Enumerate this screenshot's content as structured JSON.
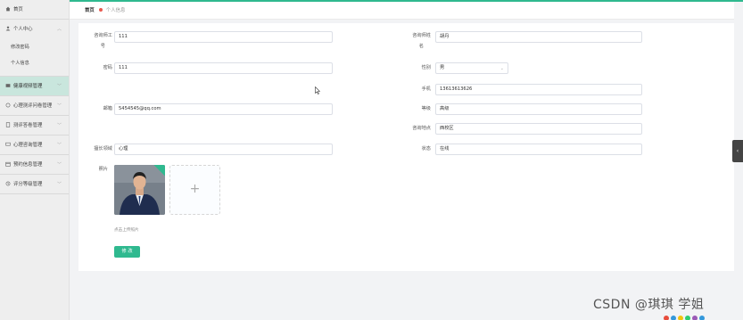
{
  "sidebar": {
    "home": "首页",
    "personal_center": "个人中心",
    "change_password": "修改密码",
    "personal_info": "个人信息",
    "items": [
      {
        "label": "健康视频管理"
      },
      {
        "label": "心理测评问卷管理"
      },
      {
        "label": "测评答卷管理"
      },
      {
        "label": "心理咨询管理"
      },
      {
        "label": "预约信息管理"
      },
      {
        "label": "评分等级管理"
      }
    ]
  },
  "breadcrumb": {
    "home": "首页",
    "current": "个人信息"
  },
  "form": {
    "left": [
      {
        "label_line1": "咨询师工",
        "label_line2": "号",
        "value": "111"
      },
      {
        "label": "密码",
        "value": "111"
      },
      {
        "label": "邮箱",
        "value": "5454545@qq.com"
      },
      {
        "label": "擅长领域",
        "value": "心理"
      }
    ],
    "right": [
      {
        "label_line1": "咨询师姓",
        "label_line2": "名",
        "value": "胡丹"
      },
      {
        "label": "性别",
        "value": "男"
      },
      {
        "label": "手机",
        "value": "13613613626"
      },
      {
        "label": "等级",
        "value": "高级"
      },
      {
        "label": "咨询地点",
        "value": "西校区"
      },
      {
        "label": "状态",
        "value": "在线"
      }
    ],
    "photo_label": "照片",
    "upload_tip": "点击上传照片",
    "submit": "修 改"
  },
  "watermark": "CSDN @琪琪 学姐",
  "colors": {
    "accent": "#2fb98f",
    "active_bg": "#c9e6dd",
    "dot": "#e85a4f"
  }
}
